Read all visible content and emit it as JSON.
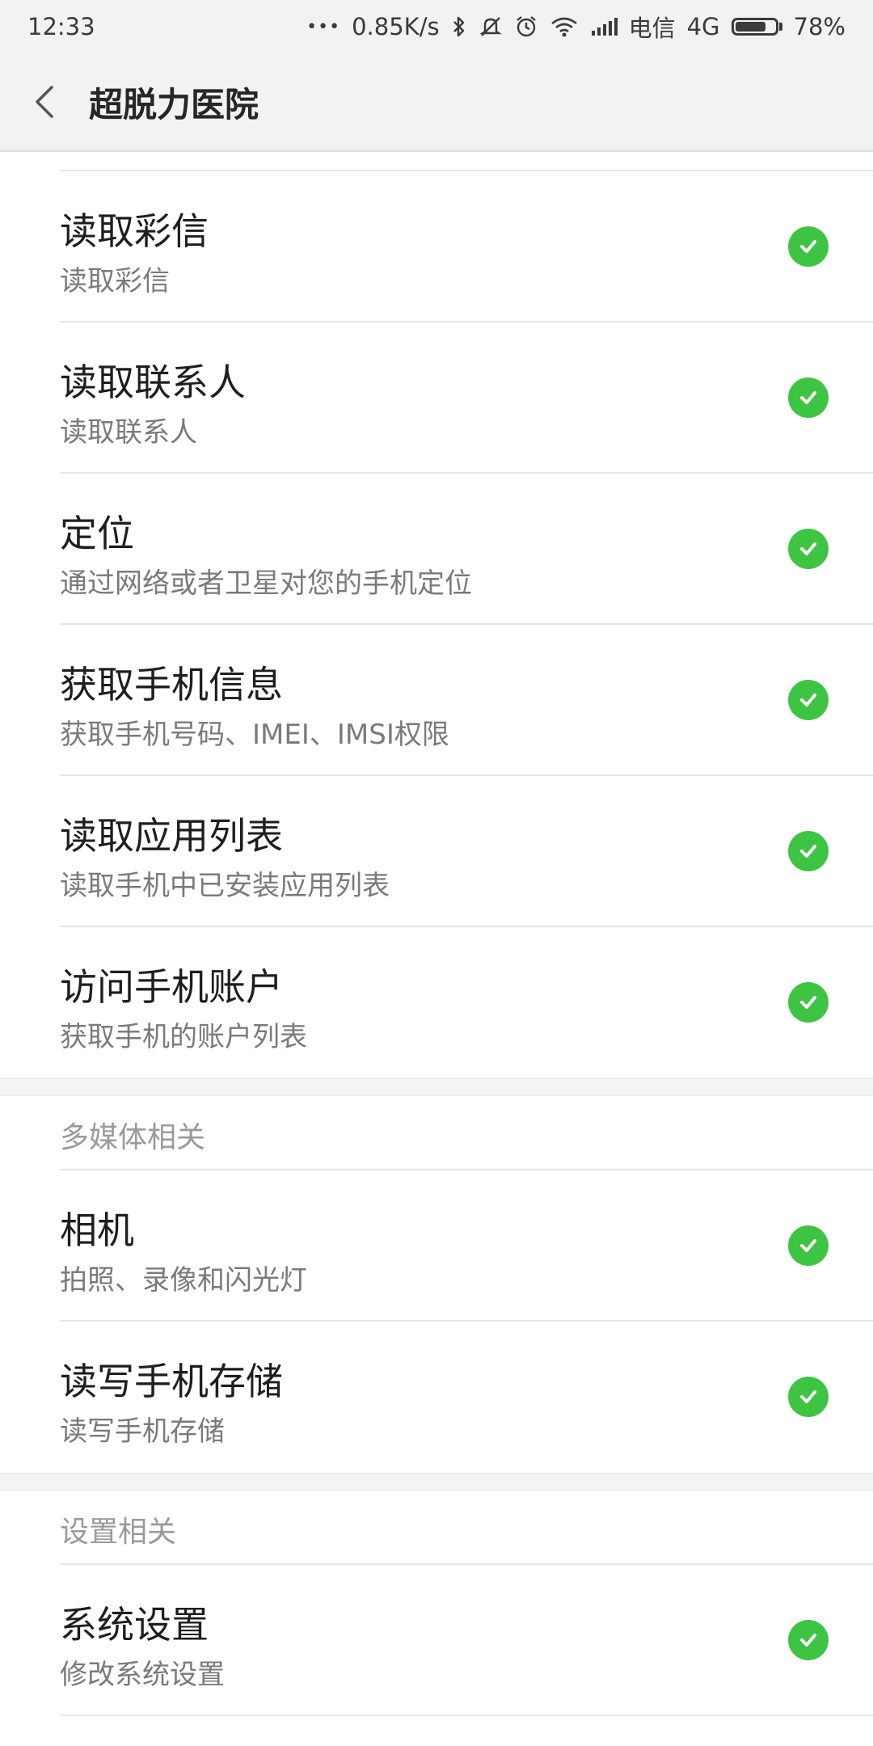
{
  "status_bar": {
    "time": "12:33",
    "dots": "•••",
    "speed": "0.85K/s",
    "carrier": "电信",
    "network": "4G",
    "battery": "78%",
    "battery_level": 0.78,
    "icons": [
      "bluetooth-icon",
      "mute-icon",
      "alarm-icon",
      "wifi-icon",
      "signal-icon",
      "battery-icon"
    ]
  },
  "header": {
    "back_icon": "chevron-left-icon",
    "title": "超脱力医院"
  },
  "colors": {
    "check": "#3ec443",
    "background": "#ffffff",
    "bar": "#f2f2f2"
  },
  "groups": [
    {
      "items": [
        {
          "title": "读取彩信",
          "subtitle": "读取彩信",
          "granted": true
        },
        {
          "title": "读取联系人",
          "subtitle": "读取联系人",
          "granted": true
        },
        {
          "title": "定位",
          "subtitle": "通过网络或者卫星对您的手机定位",
          "granted": true
        },
        {
          "title": "获取手机信息",
          "subtitle": "获取手机号码、IMEI、IMSI权限",
          "granted": true
        },
        {
          "title": "读取应用列表",
          "subtitle": "读取手机中已安装应用列表",
          "granted": true
        },
        {
          "title": "访问手机账户",
          "subtitle": "获取手机的账户列表",
          "granted": true
        }
      ]
    },
    {
      "header": "多媒体相关",
      "items": [
        {
          "title": "相机",
          "subtitle": "拍照、录像和闪光灯",
          "granted": true
        },
        {
          "title": "读写手机存储",
          "subtitle": "读写手机存储",
          "granted": true
        }
      ]
    },
    {
      "header": "设置相关",
      "items": [
        {
          "title": "系统设置",
          "subtitle": "修改系统设置",
          "granted": true
        }
      ]
    }
  ]
}
